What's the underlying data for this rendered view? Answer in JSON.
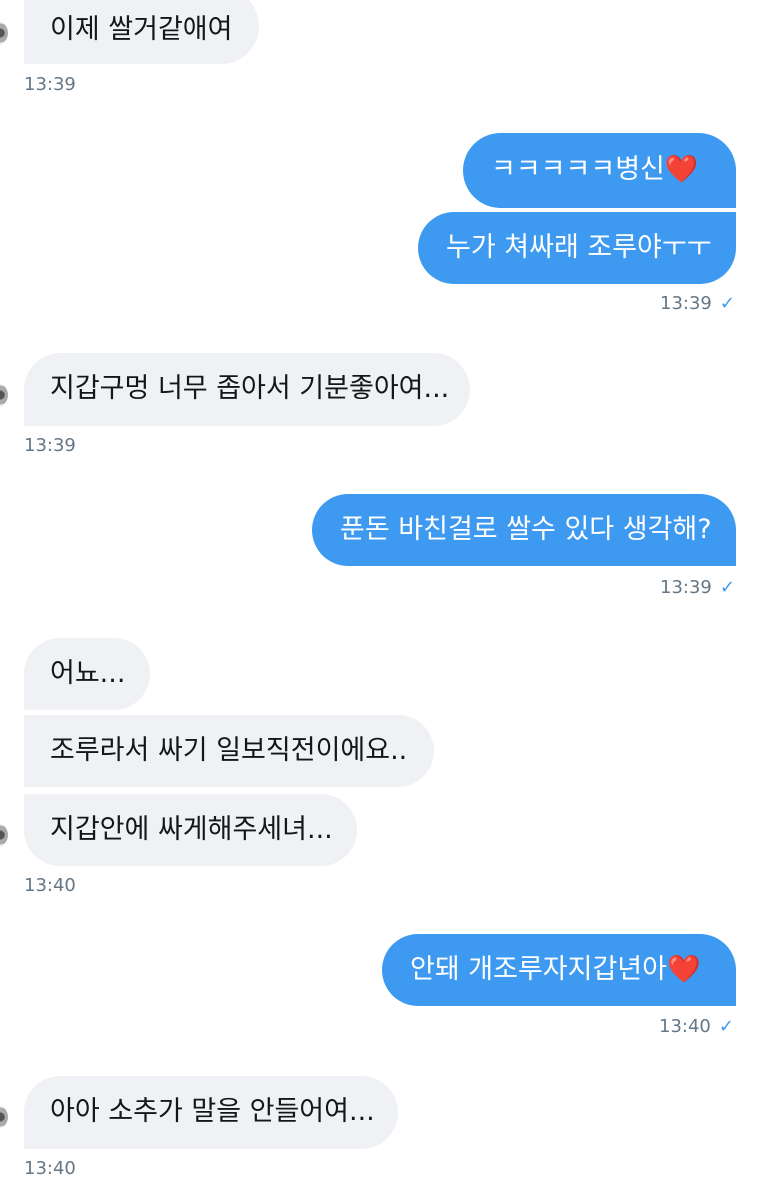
{
  "messages": {
    "m1": {
      "text": "이제 쌀거같애여",
      "time": "13:39"
    },
    "m2": {
      "text": "ㅋㅋㅋㅋㅋ병신",
      "emoji": "❤️"
    },
    "m3": {
      "text": "누가 쳐싸래 조루야ㅜㅜ",
      "time": "13:39",
      "check": "✓"
    },
    "m4": {
      "text": "지갑구멍 너무 좁아서 기분좋아여...",
      "time": "13:39"
    },
    "m5": {
      "text": "푼돈 바친걸로 쌀수 있다 생각해?",
      "time": "13:39",
      "check": "✓"
    },
    "m6": {
      "text": "어뇨..."
    },
    "m7": {
      "text": "조루라서 싸기 일보직전이에요.."
    },
    "m8": {
      "text": "지갑안에 싸게해주세녀...",
      "time": "13:40"
    },
    "m9": {
      "text": "안돼 개조루자지갑년아",
      "emoji": "❤️",
      "time": "13:40",
      "check": "✓"
    },
    "m10": {
      "text": "아아 소추가 말을 안들어여...",
      "time": "13:40"
    }
  }
}
